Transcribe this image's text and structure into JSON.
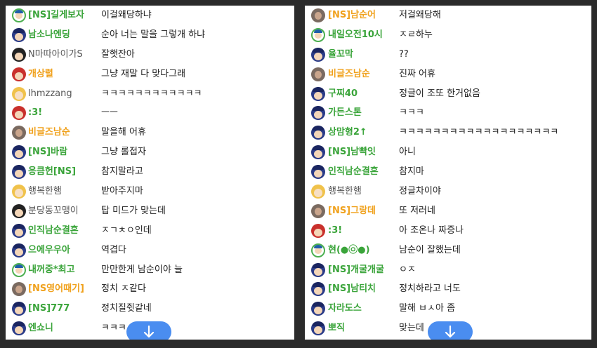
{
  "left_panel": {
    "rows": [
      {
        "avatar": "green",
        "name": "[NS]길게보자",
        "name_style": "green",
        "message": "이걸왜당하냐"
      },
      {
        "avatar": "boy",
        "name": "남소나엔딩",
        "name_style": "green",
        "message": "순아 너는 말을 그렇개 하냐"
      },
      {
        "avatar": "dark",
        "name": "N마따아이가S",
        "name_style": "gray",
        "message": "잘햇잔아"
      },
      {
        "avatar": "red",
        "name": "개상렬",
        "name_style": "orange",
        "message": "그냥 재말 다 맞다그래"
      },
      {
        "avatar": "blonde",
        "name": "lhmzzang",
        "name_style": "gray",
        "message": "ㅋㅋㅋㅋㅋㅋㅋㅋㅋㅋㅋㅋ"
      },
      {
        "avatar": "red",
        "name": ":3!",
        "name_style": "green",
        "message": "ㅡㅡ"
      },
      {
        "avatar": "photo",
        "name": "비글즈남순",
        "name_style": "orange",
        "message": "말을해 어휴"
      },
      {
        "avatar": "boy",
        "name": "[NS]바람",
        "name_style": "green",
        "message": "그냥 롤접자"
      },
      {
        "avatar": "boy",
        "name": "응큼헌[NS]",
        "name_style": "green",
        "message": "참지말라고"
      },
      {
        "avatar": "blonde",
        "name": "행복한햄",
        "name_style": "gray",
        "message": "받아주지마"
      },
      {
        "avatar": "dark",
        "name": "분당동꼬맹이",
        "name_style": "gray",
        "message": "탑 미드가 맞는데"
      },
      {
        "avatar": "boy",
        "name": "인직남순결혼",
        "name_style": "green",
        "message": "ㅈㄱㅊㅇ인데"
      },
      {
        "avatar": "boy",
        "name": "으에우우아",
        "name_style": "green",
        "message": "역겹다"
      },
      {
        "avatar": "green",
        "name": "내꺼중*최고",
        "name_style": "green",
        "message": "만만한게 남순이야 늘"
      },
      {
        "avatar": "photo",
        "name": "[NS영어때기]",
        "name_style": "orange",
        "message": "정치 ㅈ같다"
      },
      {
        "avatar": "boy",
        "name": "[NS]777",
        "name_style": "green",
        "message": "정치질쥣같네"
      },
      {
        "avatar": "boy",
        "name": "엔쇼니",
        "name_style": "green",
        "message": "ㅋㅋㅋ"
      }
    ],
    "scroll_button_icon": "arrow-down-icon"
  },
  "right_panel": {
    "rows": [
      {
        "avatar": "photo",
        "name": "[NS]남순어",
        "name_style": "orange",
        "message": "저걸왜당해"
      },
      {
        "avatar": "green",
        "name": "내일오전10시",
        "name_style": "green",
        "message": "ㅈㄹ하누"
      },
      {
        "avatar": "boy",
        "name": "율꼬막",
        "name_style": "green",
        "message": "??"
      },
      {
        "avatar": "photo",
        "name": "비글즈남순",
        "name_style": "orange",
        "message": "진짜 어휴"
      },
      {
        "avatar": "boy",
        "name": "구찌40",
        "name_style": "green",
        "message": "정글이 조또 한거없음"
      },
      {
        "avatar": "boy",
        "name": "가든스톤",
        "name_style": "green",
        "message": "ㅋㅋㅋ"
      },
      {
        "avatar": "boy",
        "name": "상맘형2↑",
        "name_style": "green",
        "message": "ㅋㅋㅋㅋㅋㅋㅋㅋㅋㅋㅋㅋㅋㅋㅋㅋㅋㅋㅋ"
      },
      {
        "avatar": "boy",
        "name": "[NS]남빡잇",
        "name_style": "green",
        "message": "아니"
      },
      {
        "avatar": "boy",
        "name": "인직남순결혼",
        "name_style": "green",
        "message": "참지마"
      },
      {
        "avatar": "blonde",
        "name": "행복한햄",
        "name_style": "gray",
        "message": "정글차이야"
      },
      {
        "avatar": "photo",
        "name": "[NS]그랑데",
        "name_style": "orange",
        "message": "또 저러네"
      },
      {
        "avatar": "red",
        "name": ":3!",
        "name_style": "green",
        "message": "아 조온나 짜증나"
      },
      {
        "avatar": "green",
        "name": "현(●㉧●)",
        "name_style": "green",
        "message": "남순이 잘했는데"
      },
      {
        "avatar": "boy",
        "name": "[NS]개굴개굴",
        "name_style": "green",
        "message": "ㅇㅈ"
      },
      {
        "avatar": "boy",
        "name": "[NS]남티치",
        "name_style": "green",
        "message": "정치하라고 너도"
      },
      {
        "avatar": "boy",
        "name": "자라도스",
        "name_style": "green",
        "message": "말해 ㅂㅅ아 좀"
      },
      {
        "avatar": "boy",
        "name": "뽀직",
        "name_style": "green",
        "message": "맞는데"
      }
    ],
    "scroll_button_icon": "arrow-down-icon"
  }
}
